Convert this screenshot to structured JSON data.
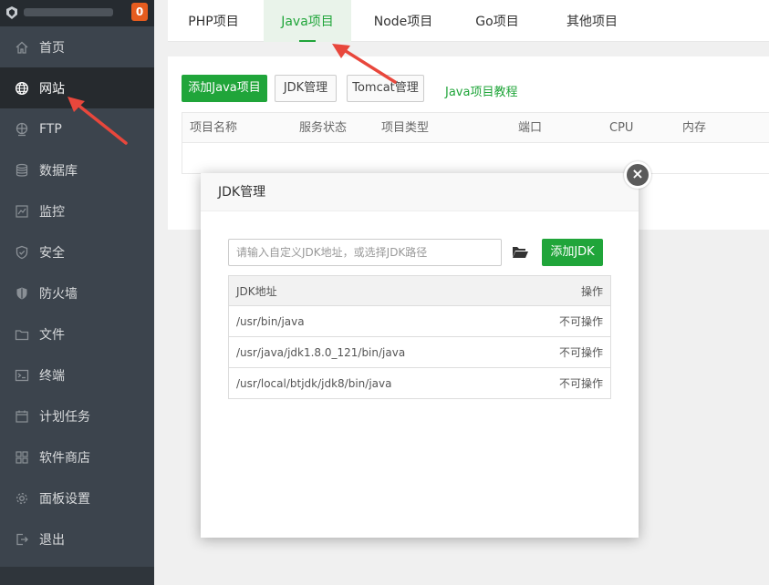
{
  "sidebar": {
    "notification_count": "0",
    "items": [
      {
        "label": "首页",
        "icon": "home-icon"
      },
      {
        "label": "网站",
        "icon": "globe-icon"
      },
      {
        "label": "FTP",
        "icon": "ftp-icon"
      },
      {
        "label": "数据库",
        "icon": "database-icon"
      },
      {
        "label": "监控",
        "icon": "monitor-icon"
      },
      {
        "label": "安全",
        "icon": "shield-icon"
      },
      {
        "label": "防火墙",
        "icon": "firewall-icon"
      },
      {
        "label": "文件",
        "icon": "folder-icon"
      },
      {
        "label": "终端",
        "icon": "terminal-icon"
      },
      {
        "label": "计划任务",
        "icon": "calendar-icon"
      },
      {
        "label": "软件商店",
        "icon": "apps-icon"
      },
      {
        "label": "面板设置",
        "icon": "gear-icon"
      },
      {
        "label": "退出",
        "icon": "logout-icon"
      }
    ],
    "active_item": "网站"
  },
  "tabs": [
    {
      "label": "PHP项目"
    },
    {
      "label": "Java项目"
    },
    {
      "label": "Node项目"
    },
    {
      "label": "Go项目"
    },
    {
      "label": "其他项目"
    }
  ],
  "active_tab": "Java项目",
  "toolbar": {
    "add_java_label": "添加Java项目",
    "jdk_manage_label": "JDK管理",
    "tomcat_manage_label": "Tomcat管理",
    "tutorial_link": "Java项目教程"
  },
  "table": {
    "columns": [
      "项目名称",
      "服务状态",
      "项目类型",
      "端口",
      "CPU",
      "内存"
    ]
  },
  "modal": {
    "title": "JDK管理",
    "close_symbol": "×",
    "input_placeholder": "请输入自定义JDK地址，或选择JDK路径",
    "input_value": "",
    "add_button_label": "添加JDK",
    "columns": {
      "path": "JDK地址",
      "action": "操作"
    },
    "rows": [
      {
        "path": "/usr/bin/java",
        "action": "不可操作"
      },
      {
        "path": "/usr/java/jdk1.8.0_121/bin/java",
        "action": "不可操作"
      },
      {
        "path": "/usr/local/btjdk/jdk8/bin/java",
        "action": "不可操作"
      }
    ]
  },
  "colors": {
    "accent_green": "#20a53a",
    "sidebar_bg": "#3c444d",
    "arrow_red": "#e8473c",
    "notification_orange": "#e65c1f"
  }
}
